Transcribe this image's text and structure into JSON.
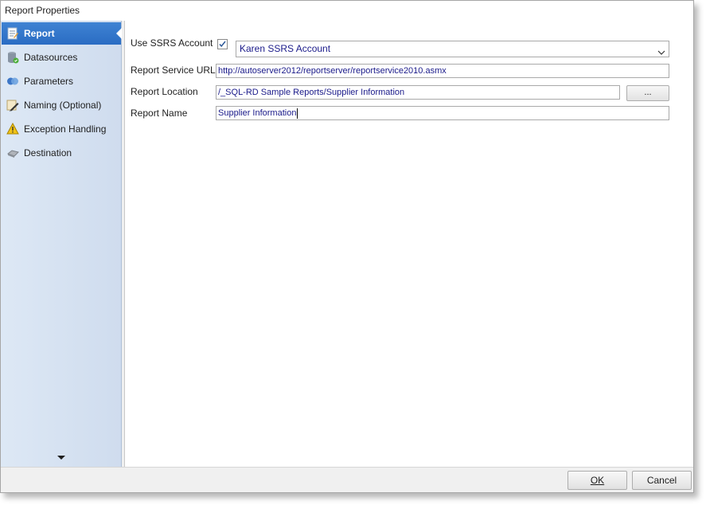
{
  "window": {
    "title": "Report Properties"
  },
  "sidebar": {
    "items": [
      {
        "label": "Report",
        "icon": "report-icon",
        "active": true
      },
      {
        "label": "Datasources",
        "icon": "database-icon",
        "active": false
      },
      {
        "label": "Parameters",
        "icon": "parameters-icon",
        "active": false
      },
      {
        "label": "Naming (Optional)",
        "icon": "pencil-icon",
        "active": false
      },
      {
        "label": "Exception Handling",
        "icon": "warning-icon",
        "active": false
      },
      {
        "label": "Destination",
        "icon": "destination-icon",
        "active": false
      }
    ],
    "accent_color": "#2f74c9"
  },
  "form": {
    "use_ssrs_account": {
      "label": "Use SSRS Account",
      "checked": true
    },
    "ssrs_account": {
      "value": "Karen SSRS Account"
    },
    "report_service_url": {
      "label": "Report  Service URL",
      "value": "http://autoserver2012/reportserver/reportservice2010.asmx"
    },
    "report_location": {
      "label": "Report Location",
      "value": "/_SQL-RD Sample Reports/Supplier Information",
      "browse_label": "..."
    },
    "report_name": {
      "label": "Report Name",
      "value": "Supplier Information"
    }
  },
  "footer": {
    "ok_label": "OK",
    "cancel_label": "Cancel"
  }
}
